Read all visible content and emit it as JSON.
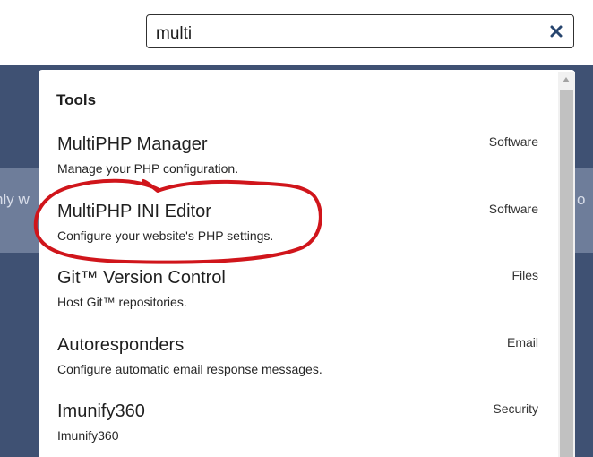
{
  "search": {
    "value": "multi"
  },
  "background": {
    "band_left_text": "nly w",
    "band_right_text": "o"
  },
  "dropdown": {
    "heading": "Tools",
    "results": [
      {
        "title": "MultiPHP Manager",
        "description": "Manage your PHP configuration.",
        "category": "Software"
      },
      {
        "title": "MultiPHP INI Editor",
        "description": "Configure your website's PHP settings.",
        "category": "Software"
      },
      {
        "title": "Git™ Version Control",
        "description": "Host Git™ repositories.",
        "category": "Files"
      },
      {
        "title": "Autoresponders",
        "description": "Configure automatic email response messages.",
        "category": "Email"
      },
      {
        "title": "Imunify360",
        "description": "Imunify360",
        "category": "Security"
      }
    ]
  },
  "annotation": {
    "color": "#d0151b",
    "circled_item": "MultiPHP INI Editor"
  },
  "icons": {
    "clear": "close-icon",
    "scroll_up": "scroll-up-arrow-icon"
  }
}
